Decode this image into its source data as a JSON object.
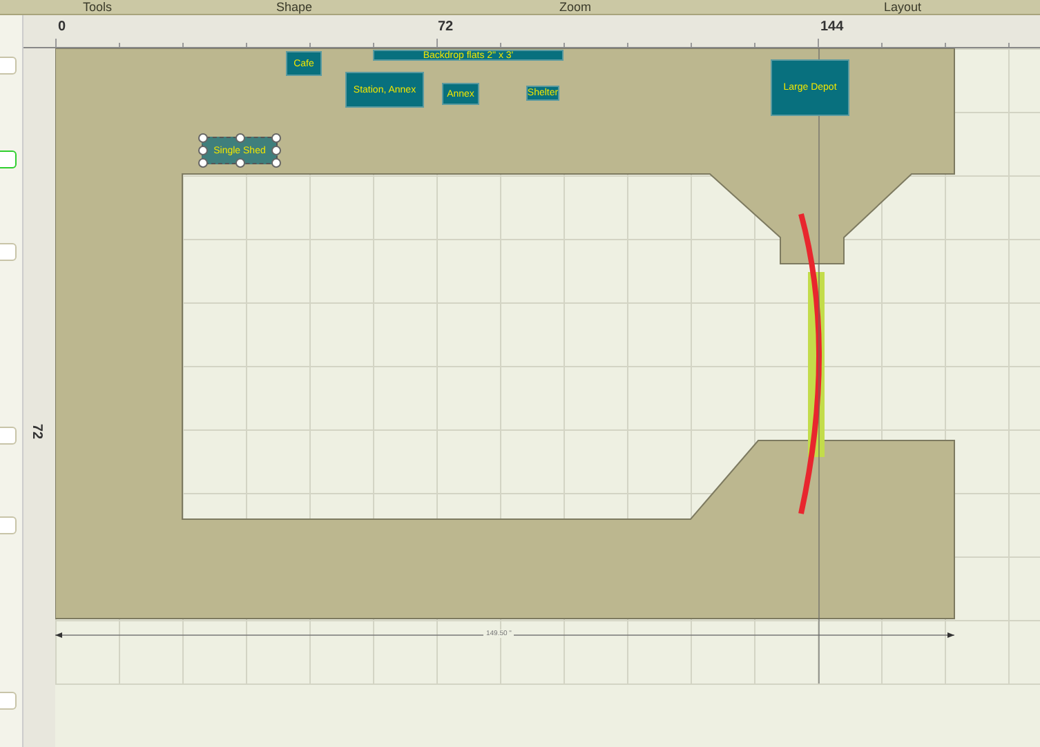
{
  "toolbar": {
    "groups": [
      "Tools",
      "Shape",
      "Zoom",
      "Layout"
    ]
  },
  "ruler": {
    "top_labels": [
      "0",
      "72",
      "144"
    ],
    "left_labels": [
      "72"
    ]
  },
  "side_panel": {
    "buttons": [
      {
        "selected": false
      },
      {
        "selected": true
      },
      {
        "selected": false
      },
      {
        "selected": false
      },
      {
        "selected": false
      },
      {
        "selected": false
      }
    ]
  },
  "canvas": {
    "buildings": [
      {
        "label": "Cafe",
        "selected": false
      },
      {
        "label": "Backdrop flats 2\" x 3'",
        "selected": false
      },
      {
        "label": "Station, Annex",
        "selected": false
      },
      {
        "label": "Annex",
        "selected": false
      },
      {
        "label": "Shelter",
        "selected": false
      },
      {
        "label": "Large Depot",
        "selected": false
      },
      {
        "label": "Single Shed",
        "selected": true
      }
    ],
    "dimension": "149.50 \""
  }
}
